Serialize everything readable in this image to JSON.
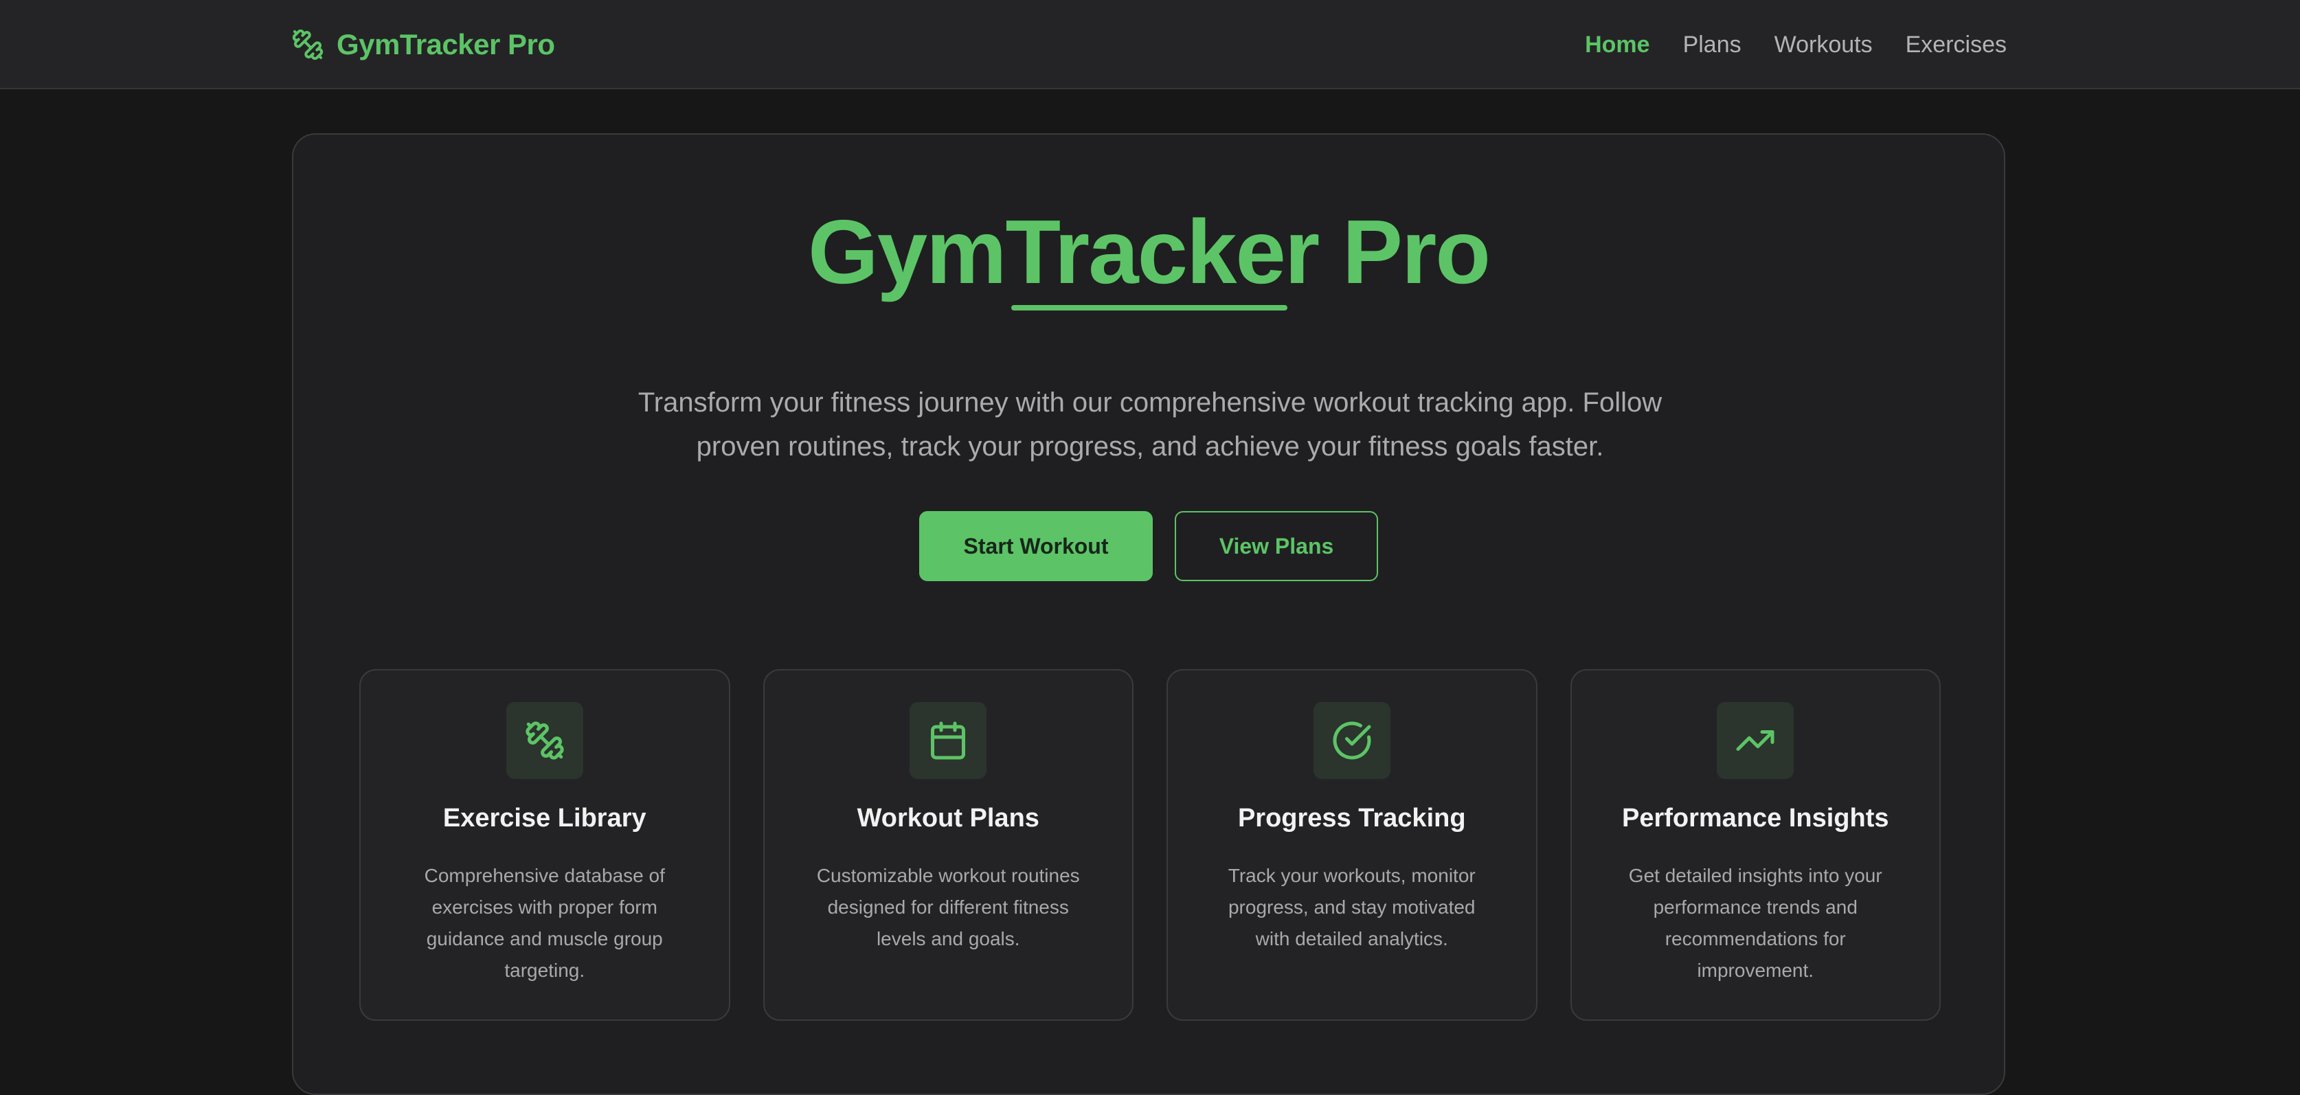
{
  "nav": {
    "brand": "GymTracker Pro",
    "brand_icon": "dumbbell-icon",
    "links": [
      {
        "label": "Home",
        "active": true
      },
      {
        "label": "Plans",
        "active": false
      },
      {
        "label": "Workouts",
        "active": false
      },
      {
        "label": "Exercises",
        "active": false
      }
    ]
  },
  "hero": {
    "title": "GymTracker Pro",
    "description": "Transform your fitness journey with our comprehensive workout tracking app. Follow proven routines, track your progress, and achieve your fitness goals faster.",
    "primary_button": "Start Workout",
    "secondary_button": "View Plans"
  },
  "features": [
    {
      "icon": "dumbbell-icon",
      "title": "Exercise Library",
      "description": "Comprehensive database of exercises with proper form guidance and muscle group targeting."
    },
    {
      "icon": "calendar-icon",
      "title": "Workout Plans",
      "description": "Customizable workout routines designed for different fitness levels and goals."
    },
    {
      "icon": "check-circle-icon",
      "title": "Progress Tracking",
      "description": "Track your workouts, monitor progress, and stay motivated with detailed analytics."
    },
    {
      "icon": "trending-up-icon",
      "title": "Performance Insights",
      "description": "Get detailed insights into your performance trends and recommendations for improvement."
    }
  ],
  "colors": {
    "accent": "#5cc466",
    "background": "#171718",
    "card": "#1f1f21",
    "navbar": "#242426"
  }
}
